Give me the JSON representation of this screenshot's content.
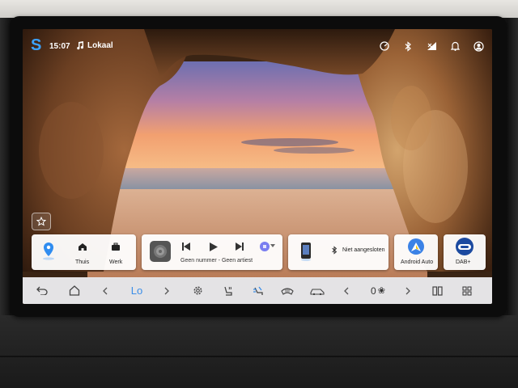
{
  "status_bar": {
    "app_logo": "S",
    "time": "15:07",
    "music_icon": "music-note-icon",
    "source": "Lokaal",
    "icons": [
      "speedometer-icon",
      "bluetooth-icon",
      "signal-icon",
      "bell-icon",
      "user-icon"
    ]
  },
  "widgets": {
    "navigation": {
      "home_label": "Thuis",
      "work_label": "Werk"
    },
    "media": {
      "track_text": "Geen nummer - Geen artiest"
    },
    "bluetooth": {
      "status": "Niet aangesloten"
    },
    "android_auto": {
      "label": "Android Auto"
    },
    "dab": {
      "label": "DAB+"
    }
  },
  "bottom_bar": {
    "temp_left": "Lo",
    "fan_level": "0",
    "fan_icon_text": "❀"
  },
  "colors": {
    "accent": "#3ca3ff",
    "widget_bg": "#f4f4f6",
    "bar_bg": "#ebebee"
  }
}
